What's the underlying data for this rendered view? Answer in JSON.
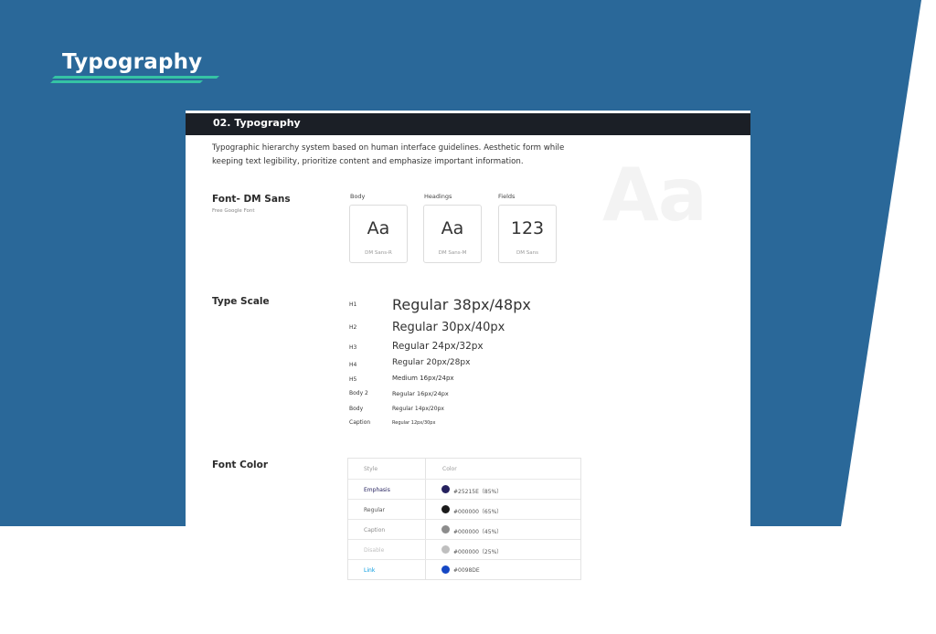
{
  "hero": {
    "title": "Typography"
  },
  "colors": {
    "background_blue": "#2a6899",
    "stripe": "#35c3a4",
    "header_dark": "#1b1f26"
  },
  "header": {
    "title": "02. Typography"
  },
  "intro": {
    "text": "Typographic hierarchy system based on human interface guidelines. Aesthetic form while keeping text legibility, prioritize content and emphasize important information."
  },
  "watermark": {
    "text": "Aa"
  },
  "font_section": {
    "title": "Font- DM Sans",
    "subtitle": "Free Google Font",
    "columns": [
      {
        "label": "Body",
        "sample": "Aa",
        "name": "DM Sans-R"
      },
      {
        "label": "Headings",
        "sample": "Aa",
        "name": "DM Sans-M"
      },
      {
        "label": "Fields",
        "sample": "123",
        "name": "DM Sans"
      }
    ]
  },
  "type_scale": {
    "title": "Type Scale",
    "rows": [
      {
        "label": "H1",
        "sample": "Regular 38px/48px"
      },
      {
        "label": "H2",
        "sample": "Regular 30px/40px"
      },
      {
        "label": "H3",
        "sample": "Regular 24px/32px"
      },
      {
        "label": "H4",
        "sample": "Regular 20px/28px"
      },
      {
        "label": "H5",
        "sample": "Medium 16px/24px"
      },
      {
        "label": "Body 2",
        "sample": "Regular 16px/24px"
      },
      {
        "label": "Body",
        "sample": "Regular 14px/20px"
      },
      {
        "label": "Caption",
        "sample": "Regular 12px/30px"
      }
    ]
  },
  "font_color": {
    "title": "Font Color",
    "headers": {
      "style": "Style",
      "color": "Color"
    },
    "rows": [
      {
        "style": "Emphasis",
        "color": "#25215E（85%）",
        "swatch": "#25215e",
        "text_color": "#25215e"
      },
      {
        "style": "Regular",
        "color": "#000000（65%）",
        "swatch": "#1a1a1a",
        "text_color": "#555555"
      },
      {
        "style": "Caption",
        "color": "#000000（45%）",
        "swatch": "#8c8c8c",
        "text_color": "#8c8c8c"
      },
      {
        "style": "Disable",
        "color": "#000000（25%）",
        "swatch": "#bfbfbf",
        "text_color": "#bfbfbf"
      },
      {
        "style": "Link",
        "color": "#0098DE",
        "swatch": "#1547c4",
        "text_color": "#0098de"
      }
    ]
  }
}
